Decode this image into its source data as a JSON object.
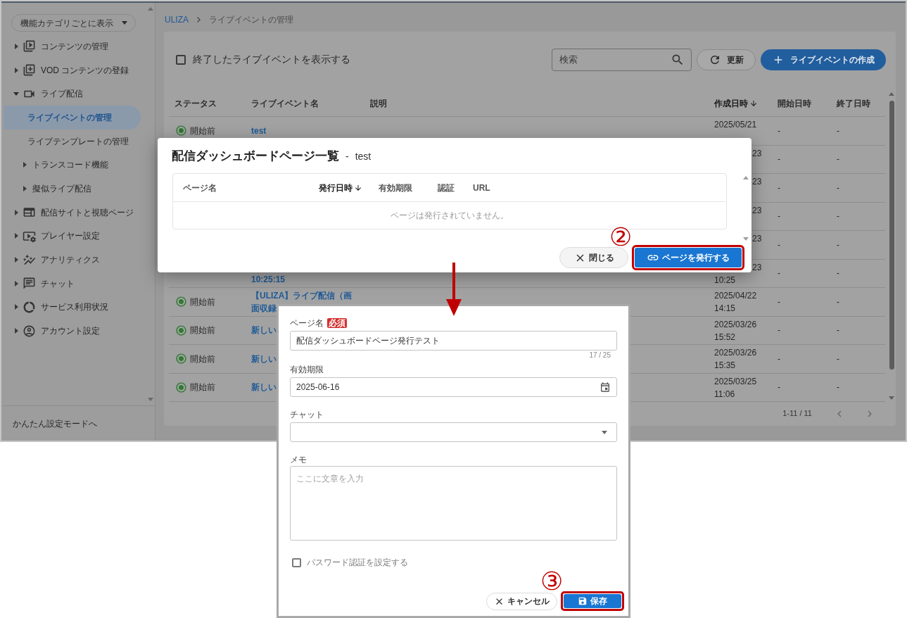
{
  "sidebar": {
    "view_button": "機能カテゴリごとに表示",
    "items": [
      {
        "label": "コンテンツの管理",
        "selected": false,
        "expanded": false
      },
      {
        "label": "VOD コンテンツの登録",
        "selected": false,
        "expanded": false
      },
      {
        "label": "ライブ配信",
        "selected": false,
        "expanded": true,
        "children": [
          {
            "label": "ライブイベントの管理",
            "selected": true
          },
          {
            "label": "ライブテンプレートの管理",
            "selected": false
          },
          {
            "label": "トランスコード機能",
            "selected": false,
            "expanded": false
          },
          {
            "label": "擬似ライブ配信",
            "selected": false,
            "expanded": false
          }
        ]
      },
      {
        "label": "配信サイトと視聴ページ",
        "selected": false,
        "expanded": false
      },
      {
        "label": "プレイヤー設定",
        "selected": false,
        "expanded": false
      },
      {
        "label": "アナリティクス",
        "selected": false,
        "expanded": false
      },
      {
        "label": "チャット",
        "selected": false,
        "expanded": false
      },
      {
        "label": "サービス利用状況",
        "selected": false,
        "expanded": false
      },
      {
        "label": "アカウント設定",
        "selected": false,
        "expanded": false
      }
    ],
    "footer_link": "かんたん設定モードへ"
  },
  "breadcrumb": [
    {
      "label": "ULIZA",
      "link": true
    },
    {
      "label": "ライブイベントの管理",
      "link": false
    }
  ],
  "toolbar": {
    "show_ended": {
      "label": "終了したライブイベントを表示する",
      "checked": false
    },
    "search": {
      "placeholder": "検索"
    },
    "refresh_button": "更新",
    "create_button": "ライブイベントの作成"
  },
  "table": {
    "columns": [
      {
        "label": "ステータス",
        "sorted": false
      },
      {
        "label": "ライブイベント名",
        "sorted": false
      },
      {
        "label": "説明",
        "sorted": false
      },
      {
        "label": "作成日時",
        "sorted": true
      },
      {
        "label": "開始日時",
        "sorted": false
      },
      {
        "label": "終了日時",
        "sorted": false
      }
    ],
    "rows": [
      {
        "status": "開始前",
        "name": [
          "test"
        ],
        "created": [
          "2025/05/21"
        ],
        "start": "-",
        "end": "-"
      },
      {
        "covered": true,
        "created": [
          "23"
        ],
        "start": "-",
        "end": "-"
      },
      {
        "covered": true,
        "created": [
          "23"
        ],
        "start": "-",
        "end": "-"
      },
      {
        "covered": true,
        "created": [
          "23"
        ],
        "start": "-",
        "end": "-"
      },
      {
        "covered": true,
        "created": [
          "23"
        ],
        "start": "-",
        "end": "-"
      },
      {
        "covered": true,
        "name": [
          "10:25:15"
        ],
        "created": [
          "23",
          "10:25"
        ],
        "start": "-",
        "end": "-"
      },
      {
        "status": "開始前",
        "name": [
          "【ULIZA】ライブ配信（画",
          "面収録"
        ],
        "created": [
          "2025/04/22",
          "14:15"
        ],
        "start": "-",
        "end": "-"
      },
      {
        "status": "開始前",
        "name": [
          "新しい"
        ],
        "created": [
          "2025/03/26",
          "15:52"
        ],
        "start": "-",
        "end": "-"
      },
      {
        "status": "開始前",
        "name": [
          "新しい"
        ],
        "created": [
          "2025/03/26",
          "15:35"
        ],
        "start": "-",
        "end": "-"
      },
      {
        "status": "開始前",
        "name": [
          "新しい"
        ],
        "created": [
          "2025/03/25",
          "11:06"
        ],
        "start": "-",
        "end": "-"
      }
    ],
    "pagination": "1-11 / 11"
  },
  "dialog": {
    "title": "配信ダッシュボードページ一覧",
    "separator": "-",
    "subtitle": "test",
    "columns": [
      {
        "label": "ページ名",
        "sorted": false
      },
      {
        "label": "発行日時",
        "sorted": true
      },
      {
        "label": "有効期限",
        "sorted": false
      },
      {
        "label": "認証",
        "sorted": false
      },
      {
        "label": "URL",
        "sorted": false
      }
    ],
    "empty_message": "ページは発行されていません。",
    "buttons": [
      {
        "kind": "secondary",
        "label": "閉じる",
        "highlighted": false
      },
      {
        "kind": "primary",
        "label": "ページを発行する",
        "highlighted": true,
        "annotation": "②"
      }
    ]
  },
  "form": {
    "fields": [
      {
        "kind": "text",
        "label": "ページ名",
        "required_badge": "必須",
        "value": "配信ダッシュボードページ発行テスト",
        "counter": "17 / 25"
      },
      {
        "kind": "date",
        "label": "有効期限",
        "value": "2025-06-16"
      },
      {
        "kind": "select",
        "label": "チャット"
      },
      {
        "kind": "textarea",
        "label": "メモ",
        "placeholder": "ここに文章を入力"
      }
    ],
    "password_option": {
      "label": "パスワード認証を設定する",
      "checked": false
    },
    "buttons": [
      {
        "kind": "secondary",
        "label": "キャンセル",
        "highlighted": false
      },
      {
        "kind": "primary",
        "label": "保存",
        "highlighted": true,
        "annotation": "③"
      }
    ]
  }
}
